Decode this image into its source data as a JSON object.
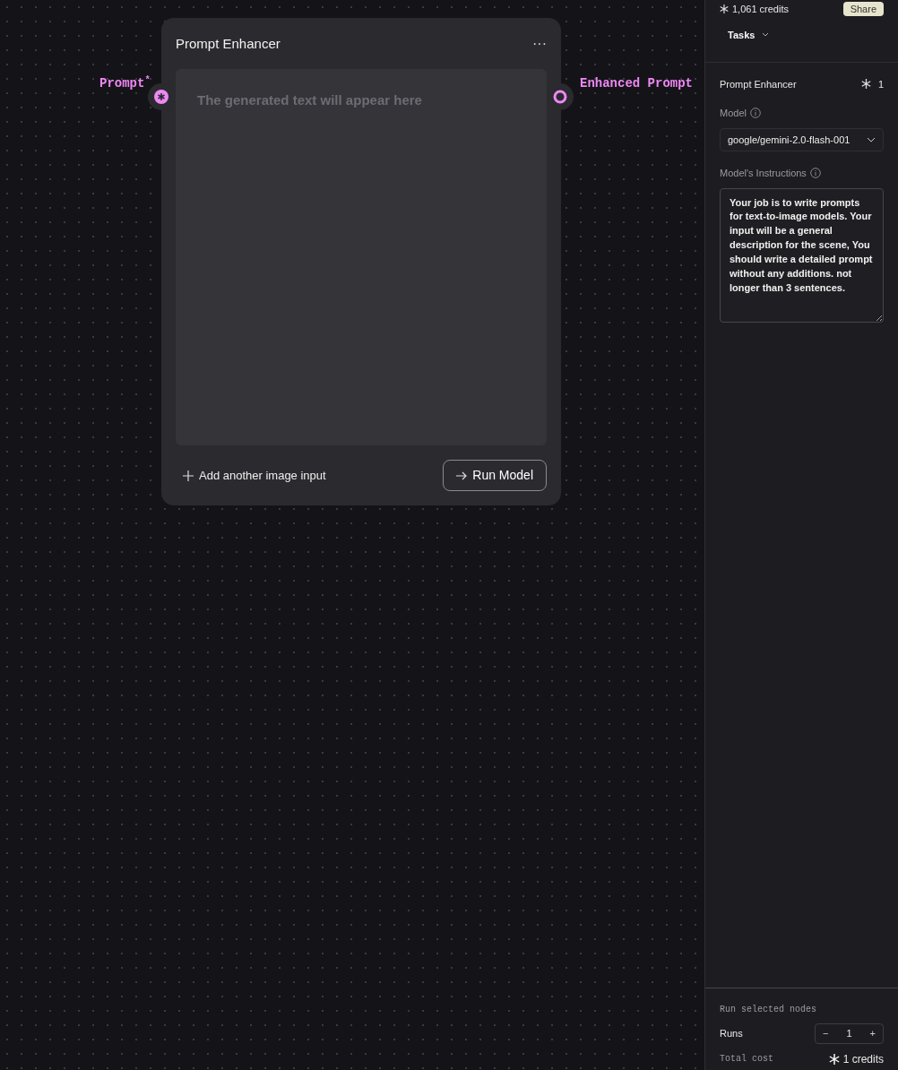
{
  "header": {
    "credits": "1,061 credits",
    "share_button": "Share",
    "tasks_menu": "Tasks"
  },
  "node": {
    "title": "Prompt Enhancer",
    "menu": "···",
    "input_handle": {
      "label": "Prompt",
      "required_mark": "*"
    },
    "output_handle": {
      "label": "Enhanced Prompt"
    },
    "output_placeholder": "The generated text will appear here",
    "add_input": "Add another image input",
    "run_button": "Run Model"
  },
  "sidebar": {
    "node_title": "Prompt Enhancer",
    "node_cost": "1",
    "model_label": "Model",
    "model_value": "google/gemini-2.0-flash-001",
    "instructions_label": "Model's Instructions",
    "instructions": "Your job is to write prompts for text-to-image models. Your input will be a general description for the scene, You should write a detailed prompt without any additions. not longer than 3 sentences."
  },
  "footer": {
    "title": "Run selected nodes",
    "runs_label": "Runs",
    "runs_decrement": "−",
    "runs_value": "1",
    "runs_increment": "+",
    "total_cost_label": "Total cost",
    "total_cost": "1 credits"
  }
}
